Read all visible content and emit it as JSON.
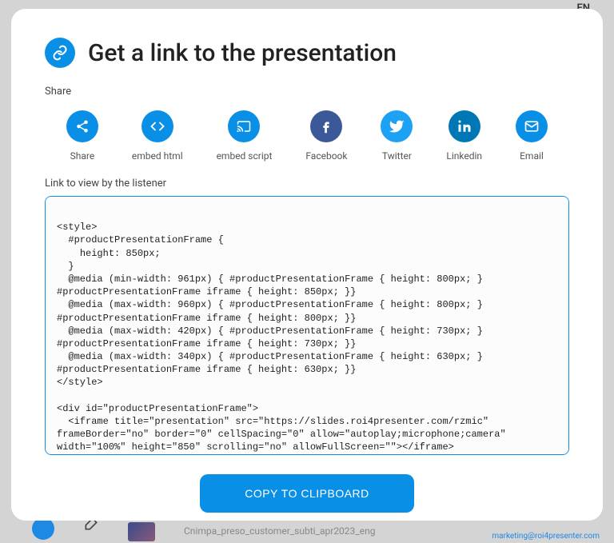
{
  "background": {
    "lang": "EN",
    "filename": "Cnimpa_preso_customer_subti_apr2023_eng",
    "email": "marketing@roi4presenter.com"
  },
  "header": {
    "title": "Get a link to the presentation"
  },
  "share": {
    "label": "Share",
    "items": [
      {
        "label": "Share"
      },
      {
        "label": "embed html"
      },
      {
        "label": "embed script"
      },
      {
        "label": "Facebook"
      },
      {
        "label": "Twitter"
      },
      {
        "label": "Linkedin"
      },
      {
        "label": "Email"
      }
    ]
  },
  "link_section": {
    "label": "Link to view by the listener",
    "code": "\n<style>\n  #productPresentationFrame {\n    height: 850px;\n  }\n  @media (min-width: 961px) { #productPresentationFrame { height: 800px; } #productPresentationFrame iframe { height: 850px; }}\n  @media (max-width: 960px) { #productPresentationFrame { height: 800px; } #productPresentationFrame iframe { height: 800px; }}\n  @media (max-width: 420px) { #productPresentationFrame { height: 730px; } #productPresentationFrame iframe { height: 730px; }}\n  @media (max-width: 340px) { #productPresentationFrame { height: 630px; } #productPresentationFrame iframe { height: 630px; }}\n</style>\n\n<div id=\"productPresentationFrame\">\n  <iframe title=\"presentation\" src=\"https://slides.roi4presenter.com/rzmic\" frameBorder=\"no\" border=\"0\" cellSpacing=\"0\" allow=\"autoplay;microphone;camera\" width=\"100%\" height=\"850\" scrolling=\"no\" allowFullScreen=\"\"></iframe>\n</div>"
  },
  "button": {
    "copy": "COPY TO CLIPBOARD"
  }
}
